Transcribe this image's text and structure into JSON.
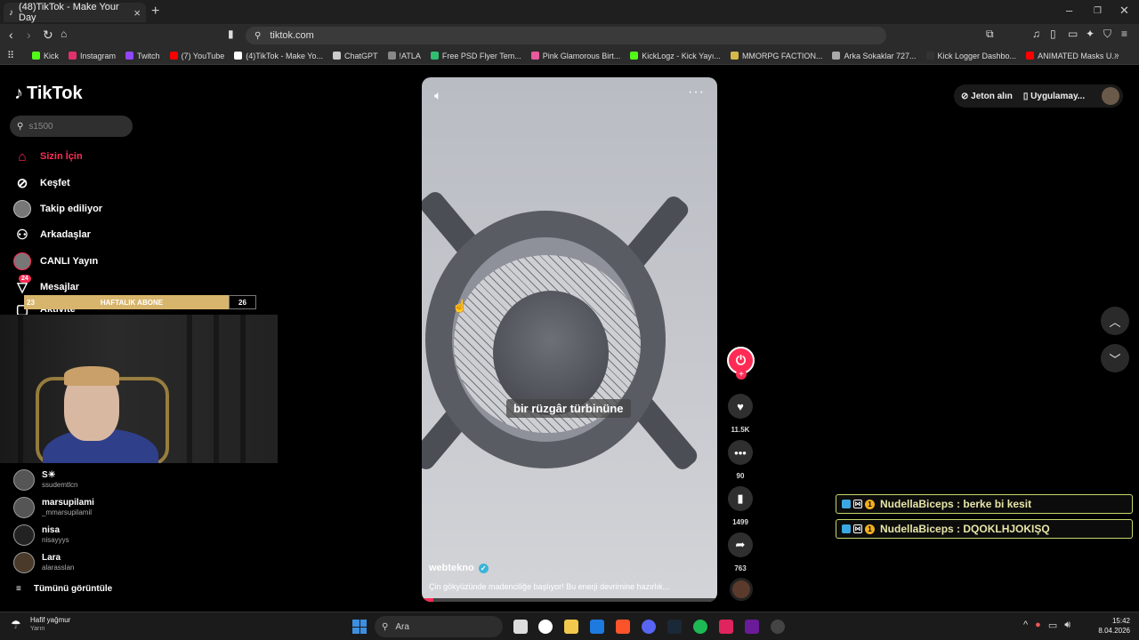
{
  "browser": {
    "tab_title": "(48)TikTok - Make Your Day",
    "new_tab": "+",
    "url": "tiktok.com",
    "bookmarks": [
      {
        "label": "Kick",
        "color": "#53fc18"
      },
      {
        "label": "Instagram",
        "color": "#e1306c"
      },
      {
        "label": "Twitch",
        "color": "#9146ff"
      },
      {
        "label": "(7) YouTube",
        "color": "#ff0000"
      },
      {
        "label": "(4)TikTok - Make Yo...",
        "color": "#ffffff"
      },
      {
        "label": "ChatGPT",
        "color": "#cccccc"
      },
      {
        "label": "!ATLA",
        "color": "#888888"
      },
      {
        "label": "Free PSD Flyer Tem...",
        "color": "#2fbf71"
      },
      {
        "label": "Pink Glamorous Birt...",
        "color": "#e85a9b"
      },
      {
        "label": "KickLogz - Kick Yayı...",
        "color": "#53fc18"
      },
      {
        "label": "MMORPG FACTION...",
        "color": "#d4b84a"
      },
      {
        "label": "Arka Sokaklar 727...",
        "color": "#aaaaaa"
      },
      {
        "label": "Kick Logger Dashbo...",
        "color": "#333333"
      },
      {
        "label": "ANIMATED Masks U...",
        "color": "#ff0000"
      }
    ]
  },
  "tiktok": {
    "logo": "TikTok",
    "search_placeholder": "s1500",
    "nav": [
      {
        "label": "Sizin İçin",
        "icon": "home-icon",
        "active": true
      },
      {
        "label": "Keşfet",
        "icon": "compass-icon"
      },
      {
        "label": "Takip ediliyor",
        "icon": "avatar"
      },
      {
        "label": "Arkadaşlar",
        "icon": "friends-icon"
      },
      {
        "label": "CANLI Yayın",
        "icon": "avatar"
      },
      {
        "label": "Mesajlar",
        "icon": "message-icon",
        "badge": "24"
      },
      {
        "label": "Aktivite",
        "icon": "activity-icon"
      }
    ],
    "sub_goal": {
      "left": "23",
      "label": "HAFTALIK ABONE",
      "right": "26"
    },
    "accounts": [
      {
        "name": "S☀",
        "username": "ssudemtlcn"
      },
      {
        "name": "marsupilami",
        "username": "_mmarsupilamil"
      },
      {
        "name": "nisa",
        "username": "nisayyys"
      },
      {
        "name": "Lara",
        "username": "alarasslan"
      }
    ],
    "see_all": "Tümünü görüntüle",
    "top_right": {
      "coins": "Jeton alın",
      "app": "Uygulamay..."
    },
    "video": {
      "caption": "bir rüzgâr türbinüne",
      "author": "webtekno",
      "description": "Çin gökyüzünde madenciliğe başlıyor! Bu enerji devrimine hazırlık...",
      "progress": 0.04
    },
    "actions": {
      "likes": "11.5K",
      "comments": "90",
      "saves": "1499",
      "shares": "763"
    }
  },
  "chat": [
    {
      "text": "NudellaBiceps : berke bi kesit"
    },
    {
      "text": "NudellaBiceps : DQOKLHJOKIŞQ"
    }
  ],
  "taskbar": {
    "weather_title": "Hafif yağmur",
    "weather_sub": "Yarın",
    "search": "Ara",
    "time": "15:42",
    "date": "8.04.2026"
  }
}
